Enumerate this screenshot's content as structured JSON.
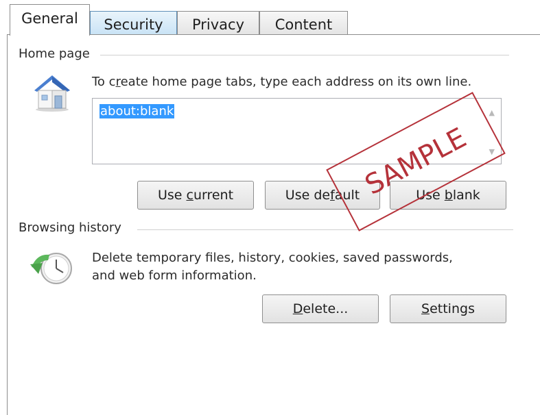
{
  "tabs": [
    {
      "label": "General",
      "active": true
    },
    {
      "label": "Security"
    },
    {
      "label": "Privacy"
    },
    {
      "label": "Content"
    }
  ],
  "home_page": {
    "title": "Home page",
    "icon": "house-icon",
    "description_pre": "To c",
    "description_u": "r",
    "description_post": "eate home page tabs, type each address on its own line.",
    "value": "about:blank",
    "buttons": {
      "use_current": {
        "pre": "Use ",
        "u": "c",
        "post": "urrent"
      },
      "use_default": {
        "pre": "Use de",
        "u": "f",
        "post": "ault"
      },
      "use_blank": {
        "pre": "Use ",
        "u": "b",
        "post": "lank"
      }
    }
  },
  "browsing_history": {
    "title": "Browsing history",
    "icon": "history-clock-icon",
    "description_line1": "Delete temporary files, history, cookies, saved passwords,",
    "description_line2": "and web form information.",
    "buttons": {
      "delete": {
        "u": "D",
        "post": "elete..."
      },
      "settings": {
        "u": "S",
        "post": "ettings"
      }
    }
  },
  "stamp": "SAMPLE",
  "colors": {
    "selection": "#3399ff",
    "stamp": "#b5323a",
    "tab_highlight": "#c9e3f6"
  }
}
